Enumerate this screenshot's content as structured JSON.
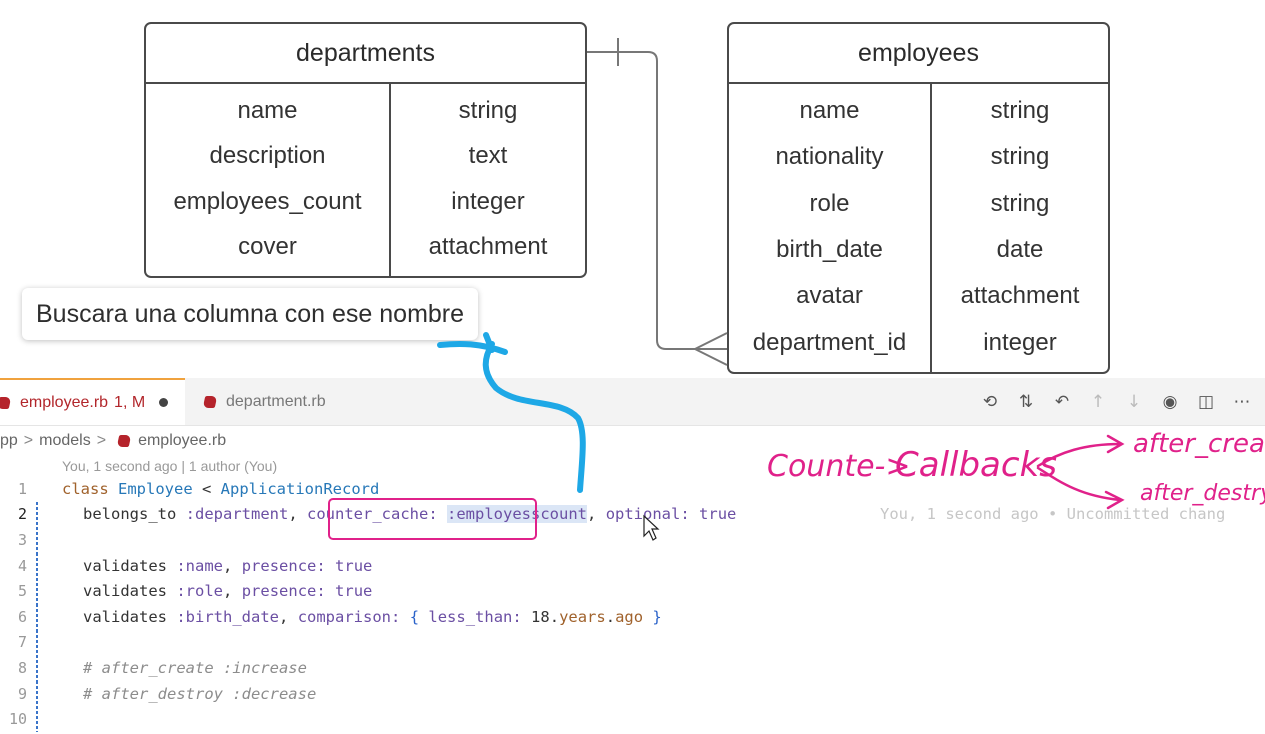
{
  "diagram": {
    "departments": {
      "title": "departments",
      "fields": [
        {
          "name": "name",
          "type": "string"
        },
        {
          "name": "description",
          "type": "text"
        },
        {
          "name": "employees_count",
          "type": "integer"
        },
        {
          "name": "cover",
          "type": "attachment"
        }
      ]
    },
    "employees": {
      "title": "employees",
      "fields": [
        {
          "name": "name",
          "type": "string"
        },
        {
          "name": "nationality",
          "type": "string"
        },
        {
          "name": "role",
          "type": "string"
        },
        {
          "name": "birth_date",
          "type": "date"
        },
        {
          "name": "avatar",
          "type": "attachment"
        },
        {
          "name": "department_id",
          "type": "integer"
        }
      ]
    }
  },
  "tooltip": {
    "text": "Buscara una columna con ese nombre"
  },
  "tabs": [
    {
      "label": "employee.rb",
      "status": "1, M"
    },
    {
      "label": "department.rb"
    }
  ],
  "toolbar_icons": [
    "history-icon",
    "compare-changes-icon",
    "go-back-icon",
    "previous-change-icon",
    "next-change-icon",
    "git-graph-icon",
    "split-editor-icon",
    "more-actions-icon"
  ],
  "breadcrumb": {
    "root": "pp",
    "folder": "models",
    "file": "employee.rb"
  },
  "blame": "You, 1 second ago | 1 author (You)",
  "code": {
    "line_numbers": [
      "1",
      "2",
      "3",
      "4",
      "5",
      "6",
      "7",
      "8",
      "9",
      "10"
    ],
    "l1": {
      "kw": "class",
      "cls": "Employee",
      "op": " < ",
      "parent": "ApplicationRecord"
    },
    "l2": {
      "method": "belongs_to",
      "sym1": ":department",
      "comma": ",",
      "key1": "counter_cache:",
      "sym2": ":employesscount",
      "comma2": ",",
      "key2": "optional:",
      "val2": "true"
    },
    "l2_ghost": "You, 1 second ago • Uncommitted chang",
    "l4": {
      "method": "validates",
      "sym": ":name",
      "key": "presence:",
      "val": "true"
    },
    "l5": {
      "method": "validates",
      "sym": ":role",
      "key": "presence:",
      "val": "true"
    },
    "l6": {
      "method": "validates",
      "sym": ":birth_date",
      "key": "comparison:",
      "open": "{",
      "key2": "less_than:",
      "num": "18",
      "dot1": ".",
      "m1": "years",
      "dot2": ".",
      "m2": "ago",
      "close": "}"
    },
    "l8": "# after_create :increase",
    "l9": "# after_destroy :decrease"
  },
  "annotations": {
    "counter": "Counte->",
    "callbacks": "Callbacks",
    "after_create": "after_crea",
    "after_destroy": "after_destry"
  },
  "colors": {
    "highlight_box": "#e0218a",
    "arrow": "#1ea8e6",
    "active_tab_border": "#f0a23d"
  }
}
